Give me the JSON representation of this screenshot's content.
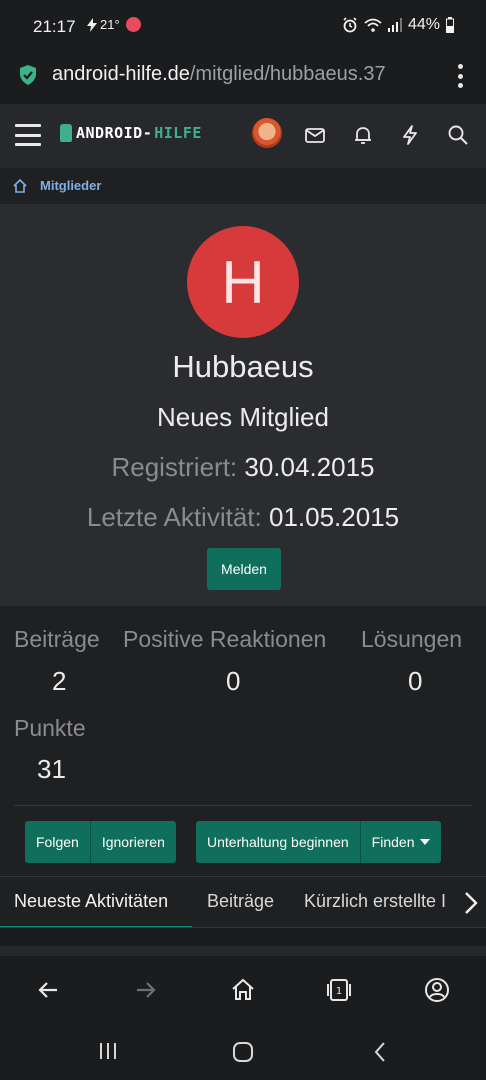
{
  "status_bar": {
    "time": "21:17",
    "temperature": "21°",
    "battery": "44%"
  },
  "browser": {
    "url_domain": "android-hilfe.de",
    "url_path": "/mitglied/hubbaeus.37"
  },
  "site_header": {
    "logo_main": "ANDROID-",
    "logo_accent": "HILFE",
    "icons": [
      "menu-icon",
      "avatar",
      "mail-icon",
      "bell-icon",
      "bolt-icon",
      "search-icon"
    ]
  },
  "breadcrumb": {
    "label": "Mitglieder"
  },
  "profile": {
    "avatar_letter": "H",
    "username": "Hubbaeus",
    "user_title": "Neues Mitglied",
    "registered_label": "Registriert:",
    "registered_value": "30.04.2015",
    "last_activity_label": "Letzte Aktivität:",
    "last_activity_value": "01.05.2015",
    "report_button": "Melden",
    "accent_color": "#0f6e5c",
    "avatar_color": "#d63a3a"
  },
  "stats": {
    "posts_label": "Beiträge",
    "posts_value": "2",
    "reactions_label": "Positive Reaktionen",
    "reactions_value": "0",
    "solutions_label": "Lösungen",
    "solutions_value": "0",
    "points_label": "Punkte",
    "points_value": "31"
  },
  "actions": {
    "follow": "Folgen",
    "ignore": "Ignorieren",
    "start_conversation": "Unterhaltung beginnen",
    "find": "Finden"
  },
  "tabs": {
    "items": [
      "Neueste Aktivitäten",
      "Beiträge",
      "Kürzlich erstellte I"
    ]
  }
}
